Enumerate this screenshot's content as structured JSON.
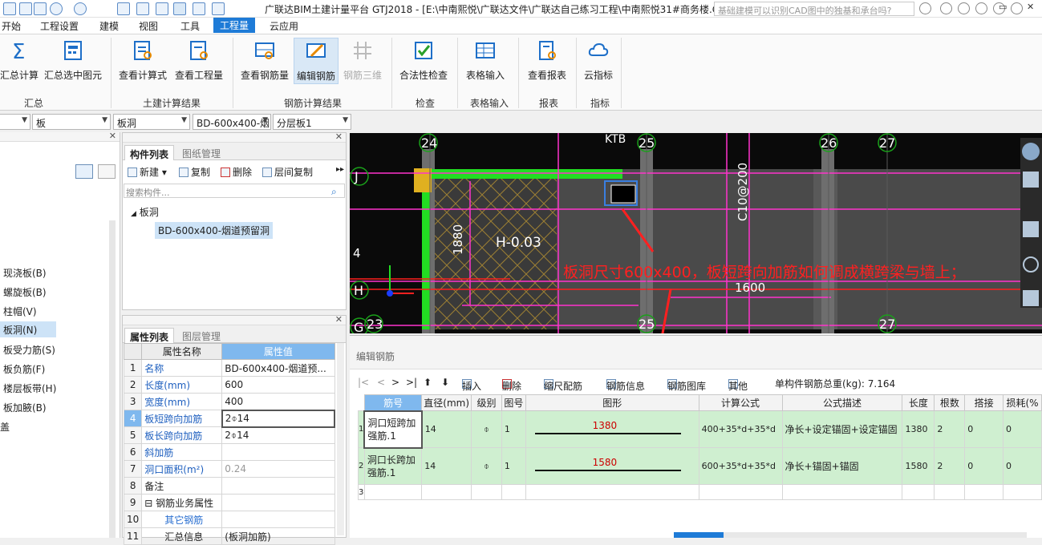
{
  "window": {
    "title": "广联达BIM土建计量平台 GTJ2018 - [E:\\中南熙悦\\广联达文件\\广联达自己练习工程\\中南熙悦31#商务楼.GTJ]",
    "search_placeholder": "基础建模可以识别CAD图中的独基和承台吗?",
    "win_restore": "▭",
    "win_close": "✕"
  },
  "menu": [
    "开始",
    "工程设置",
    "建模",
    "视图",
    "工具",
    "工程量",
    "云应用"
  ],
  "menu_active": "工程量",
  "ribbon": {
    "buttons": [
      {
        "label": "汇总计算",
        "icon": "sigma-icon"
      },
      {
        "label": "汇总选中图元",
        "icon": "calc-selected-icon"
      },
      {
        "label": "查看计算式",
        "icon": "view-formula-icon"
      },
      {
        "label": "查看工程量",
        "icon": "view-quantity-icon"
      },
      {
        "label": "查看钢筋量",
        "icon": "view-rebar-icon"
      },
      {
        "label": "编辑钢筋",
        "icon": "edit-rebar-icon"
      },
      {
        "label": "钢筋三维",
        "icon": "rebar-3d-icon"
      },
      {
        "label": "合法性检查",
        "icon": "check-icon"
      },
      {
        "label": "表格输入",
        "icon": "table-input-icon"
      },
      {
        "label": "查看报表",
        "icon": "report-icon"
      },
      {
        "label": "云指标",
        "icon": "cloud-icon"
      }
    ],
    "groups": [
      "汇总",
      "土建计算结果",
      "钢筋计算结果",
      "检查",
      "表格输入",
      "报表",
      "指标"
    ]
  },
  "filters": {
    "c0": "",
    "c1": "板",
    "c2": "板洞",
    "c3": "BD-600x400-烟",
    "c4": "分层板1",
    "arrow": "▼"
  },
  "leftnav": {
    "items": [
      "现浇板(B)",
      "螺旋板(B)",
      "柱帽(V)",
      "板洞(N)",
      "板受力筋(S)",
      "板负筋(F)",
      "楼层板带(H)",
      "板加腋(B)",
      "盖"
    ],
    "selected": "板洞(N)"
  },
  "component_list": {
    "tabs": [
      "构件列表",
      "图纸管理"
    ],
    "toolbar": [
      "新建",
      "复制",
      "删除",
      "层间复制"
    ],
    "search_placeholder": "搜索构件...",
    "tree_root": "板洞",
    "tree_child": "BD-600x400-烟道预留洞"
  },
  "property_list": {
    "tabs": [
      "属性列表",
      "图层管理"
    ],
    "headers": [
      "属性名称",
      "属性值"
    ],
    "rows": [
      {
        "n": "1",
        "name": "名称",
        "value": "BD-600x400-烟道预..."
      },
      {
        "n": "2",
        "name": "长度(mm)",
        "value": "600"
      },
      {
        "n": "3",
        "name": "宽度(mm)",
        "value": "400"
      },
      {
        "n": "4",
        "name": "板短跨向加筋",
        "value": "2⌽14"
      },
      {
        "n": "5",
        "name": "板长跨向加筋",
        "value": "2⌽14"
      },
      {
        "n": "6",
        "name": "斜加筋",
        "value": ""
      },
      {
        "n": "7",
        "name": "洞口面积(m²)",
        "value": "0.24"
      },
      {
        "n": "8",
        "name": "备注",
        "value": ""
      },
      {
        "n": "9",
        "name": "⊟ 钢筋业务属性",
        "value": ""
      },
      {
        "n": "10",
        "name": "其它钢筋",
        "value": ""
      },
      {
        "n": "11",
        "name": "汇总信息",
        "value": "(板洞加筋)"
      }
    ]
  },
  "cad": {
    "axis_top": [
      "24",
      "25",
      "26",
      "27"
    ],
    "axis_bottom": [
      "23",
      "25",
      "27"
    ],
    "axis_left": [
      "J",
      "H",
      "G"
    ],
    "texts": {
      "ktb": "KTB",
      "c10": "C10@200",
      "h003": "H-0.03",
      "d1880": "1880",
      "d1600": "1600",
      "four": "4"
    },
    "annotation": "板洞尺寸600x400，板短跨向加筋如何调成横跨梁与墙上；"
  },
  "edit_rebar": {
    "title": "编辑钢筋",
    "toolbar": [
      "插入",
      "删除",
      "缩尺配筋",
      "钢筋信息",
      "钢筋图库",
      "其他",
      "单构件钢筋总重(kg): 7.164"
    ],
    "columns": [
      "筋号",
      "直径(mm)",
      "级别",
      "图号",
      "图形",
      "计算公式",
      "公式描述",
      "长度",
      "根数",
      "搭接",
      "损耗(%"
    ],
    "rows": [
      {
        "n": "1",
        "name": "洞口短跨加强筋.1",
        "dia": "14",
        "grade": "⌽",
        "fig": "1",
        "len_shape": "1380",
        "formula": "400+35*d+35*d",
        "desc": "净长+设定锚固+设定锚固",
        "length": "1380",
        "count": "2",
        "lap": "0",
        "loss": "0"
      },
      {
        "n": "2",
        "name": "洞口长跨加强筋.1",
        "dia": "14",
        "grade": "⌽",
        "fig": "1",
        "len_shape": "1580",
        "formula": "600+35*d+35*d",
        "desc": "净长+锚固+锚固",
        "length": "1580",
        "count": "2",
        "lap": "0",
        "loss": "0"
      },
      {
        "n": "3"
      }
    ]
  },
  "colors": {
    "accent": "#1e7bd7",
    "selected_row": "#cfefd0",
    "annotation_red": "#ff2020",
    "cad_green": "#22dd22",
    "cad_magenta": "#ff33cc"
  }
}
